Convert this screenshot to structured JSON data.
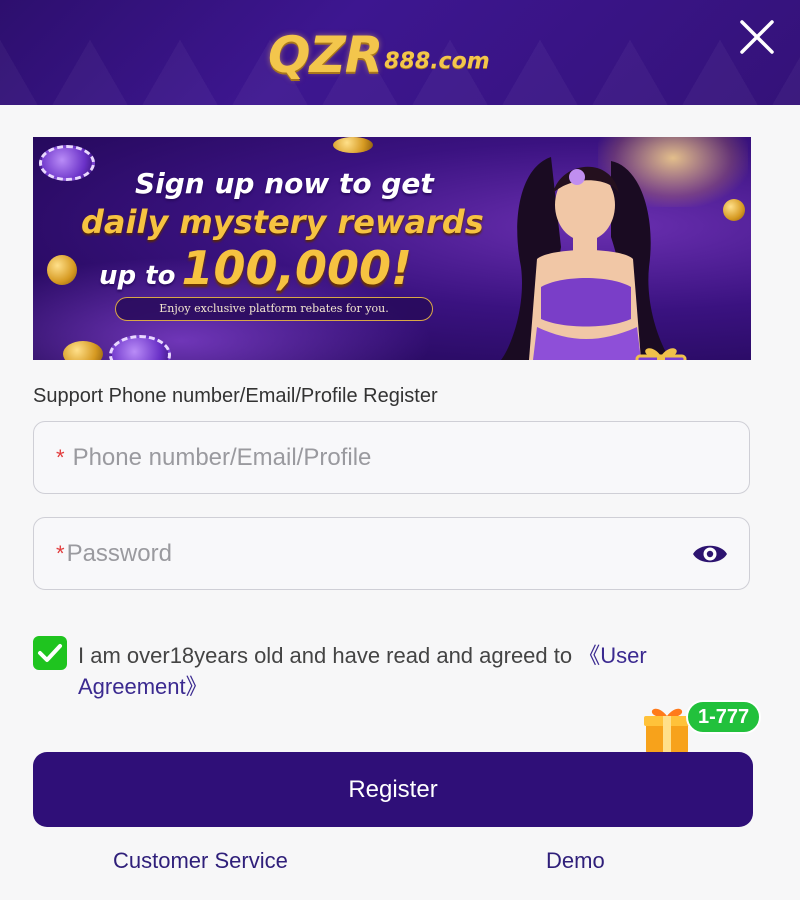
{
  "header": {
    "logo_main": "QZR",
    "logo_domain": "888.com",
    "logo_chip_text": "888"
  },
  "banner": {
    "line1": "Sign up now to get",
    "line2": "daily mystery rewards",
    "line3_prefix": "up to",
    "line3_amount": "100,000!",
    "subtitle": "Enjoy exclusive platform rebates for you."
  },
  "form": {
    "support_text": "Support Phone number/Email/Profile Register",
    "account_required_mark": "*",
    "account_placeholder": "Phone number/Email/Profile",
    "password_required_mark": "*",
    "password_placeholder": "Password",
    "agree_text": "I am over18years old and have read and agreed to ",
    "agree_link": "《User Agreement》",
    "agree_checked": true
  },
  "promo_badge": {
    "label": "1-777"
  },
  "actions": {
    "register_label": "Register",
    "customer_service_label": "Customer Service",
    "demo_label": "Demo"
  },
  "colors": {
    "header": "#3d1690",
    "primary": "#2f0f78",
    "gold": "#f3c64c",
    "check": "#1fc41f",
    "required": "#e23c3c"
  }
}
